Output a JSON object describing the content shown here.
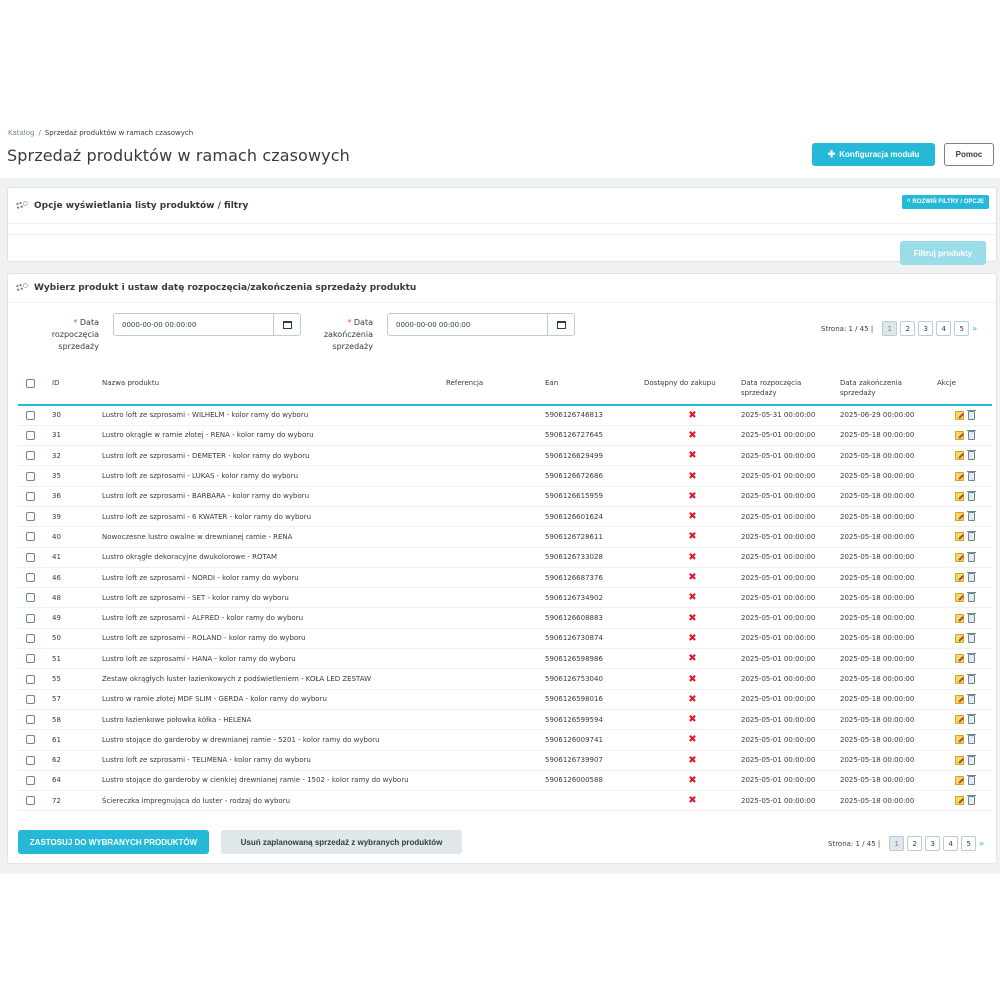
{
  "breadcrumb": {
    "parent": "Katalog",
    "separator": "/",
    "current": "Sprzedaż produktów w ramach czasowych"
  },
  "page": {
    "title": "Sprzedaż produktów w ramach czasowych"
  },
  "toolbar": {
    "config_label": "Konfiguracja modułu",
    "help_label": "Pomoc"
  },
  "filters_panel": {
    "title": "Opcje wyświetlania listy produktów / filtry",
    "expand_label": "ROZWIŃ FILTRY / OPCJE",
    "filter_button": "Filtruj produkty"
  },
  "products_panel": {
    "title": "Wybierz produkt i ustaw datę rozpoczęcia/zakończenia sprzedaży produktu",
    "start_label_1": "Data",
    "start_label_2": "rozpoczęcia",
    "start_label_3": "sprzedaży",
    "end_label_1": "Data",
    "end_label_2": "zakończenia",
    "end_label_3": "sprzedaży",
    "required_mark": "*",
    "start_value": "0000-00-00 00:00:00",
    "end_value": "0000-00-00 00:00:00",
    "apply_button": "ZASTOSUJ DO WYBRANYCH PRODUKTÓW",
    "remove_button": "Usuń zaplanowaną sprzedaż z wybranych produktów"
  },
  "pagination": {
    "info": "Strona: 1 / 45",
    "separator": "|",
    "pages": [
      "1",
      "2",
      "3",
      "4",
      "5"
    ],
    "next": "»"
  },
  "table": {
    "headers": {
      "id": "ID",
      "name": "Nazwa produktu",
      "reference": "Referencja",
      "ean": "Ean",
      "available": "Dostępny do zakupu",
      "start_1": "Data rozpoczęcia",
      "start_2": "sprzedaży",
      "end_1": "Data zakończenia",
      "end_2": "sprzedaży",
      "actions": "Akcje"
    },
    "rows": [
      {
        "id": "30",
        "name": "Lustro loft ze szprosami - WILHELM - kolor ramy do wyboru",
        "ref": "",
        "ean": "5906126746813",
        "start": "2025-05-31 00:00:00",
        "end": "2025-06-29 00:00:00"
      },
      {
        "id": "31",
        "name": "Lustro okrągłe w ramie złotej - RENA - kolor ramy do wyboru",
        "ref": "",
        "ean": "5906126727645",
        "start": "2025-05-01 00:00:00",
        "end": "2025-05-18 00:00:00"
      },
      {
        "id": "32",
        "name": "Lustro loft ze szprosami - DEMETER - kolor ramy do wyboru",
        "ref": "",
        "ean": "5906126629499",
        "start": "2025-05-01 00:00:00",
        "end": "2025-05-18 00:00:00"
      },
      {
        "id": "35",
        "name": "Lustro loft ze szprosami - LUKAS - kolor ramy do wyboru",
        "ref": "",
        "ean": "5906126672686",
        "start": "2025-05-01 00:00:00",
        "end": "2025-05-18 00:00:00"
      },
      {
        "id": "36",
        "name": "Lustro loft ze szprosami - BARBARA - kolor ramy do wyboru",
        "ref": "",
        "ean": "5906126615959",
        "start": "2025-05-01 00:00:00",
        "end": "2025-05-18 00:00:00"
      },
      {
        "id": "39",
        "name": "Lustro loft ze szprosami - 6 KWATER - kolor ramy do wyboru",
        "ref": "",
        "ean": "5906126601624",
        "start": "2025-05-01 00:00:00",
        "end": "2025-05-18 00:00:00"
      },
      {
        "id": "40",
        "name": "Nowoczesne lustro owalne w drewnianej ramie - RENA",
        "ref": "",
        "ean": "5906126728611",
        "start": "2025-05-01 00:00:00",
        "end": "2025-05-18 00:00:00"
      },
      {
        "id": "41",
        "name": "Lustro okrągłe dekoracyjne dwukolorowe - ROTAM",
        "ref": "",
        "ean": "5906126733028",
        "start": "2025-05-01 00:00:00",
        "end": "2025-05-18 00:00:00"
      },
      {
        "id": "46",
        "name": "Lustro loft ze szprosami - NORDI - kolor ramy do wyboru",
        "ref": "",
        "ean": "5906126687376",
        "start": "2025-05-01 00:00:00",
        "end": "2025-05-18 00:00:00"
      },
      {
        "id": "48",
        "name": "Lustro loft ze szprosami - SET - kolor ramy do wyboru",
        "ref": "",
        "ean": "5906126734902",
        "start": "2025-05-01 00:00:00",
        "end": "2025-05-18 00:00:00"
      },
      {
        "id": "49",
        "name": "Lustro loft ze szprosami - ALFRED - kolor ramy do wyboru",
        "ref": "",
        "ean": "5906126608883",
        "start": "2025-05-01 00:00:00",
        "end": "2025-05-18 00:00:00"
      },
      {
        "id": "50",
        "name": "Lustro loft ze szprosami - ROLAND - kolor ramy do wyboru",
        "ref": "",
        "ean": "5906126730874",
        "start": "2025-05-01 00:00:00",
        "end": "2025-05-18 00:00:00"
      },
      {
        "id": "51",
        "name": "Lustro loft ze szprosami - HANA - kolor ramy do wyboru",
        "ref": "",
        "ean": "5906126598986",
        "start": "2025-05-01 00:00:00",
        "end": "2025-05-18 00:00:00"
      },
      {
        "id": "55",
        "name": "Zestaw okrągłych luster łazienkowych z podświetleniem - KOŁA LED ZESTAW",
        "ref": "",
        "ean": "5906126753040",
        "start": "2025-05-01 00:00:00",
        "end": "2025-05-18 00:00:00"
      },
      {
        "id": "57",
        "name": "Lustro w ramie złotej MDF SLIM - GERDA - kolor ramy do wyboru",
        "ref": "",
        "ean": "5906126598016",
        "start": "2025-05-01 00:00:00",
        "end": "2025-05-18 00:00:00"
      },
      {
        "id": "58",
        "name": "Lustro łazienkowe połowka kółka - HELENA",
        "ref": "",
        "ean": "5906126599594",
        "start": "2025-05-01 00:00:00",
        "end": "2025-05-18 00:00:00"
      },
      {
        "id": "61",
        "name": "Lustro stojące do garderoby w drewnianej ramie - 5201 - kolor ramy do wyboru",
        "ref": "",
        "ean": "5906126009741",
        "start": "2025-05-01 00:00:00",
        "end": "2025-05-18 00:00:00"
      },
      {
        "id": "62",
        "name": "Lustro loft ze szprosami - TELIMENA - kolor ramy do wyboru",
        "ref": "",
        "ean": "5906126739907",
        "start": "2025-05-01 00:00:00",
        "end": "2025-05-18 00:00:00"
      },
      {
        "id": "64",
        "name": "Lustro stojące do garderoby w cienkiej drewnianej ramie - 1502 - kolor ramy do wyboru",
        "ref": "",
        "ean": "5906126000588",
        "start": "2025-05-01 00:00:00",
        "end": "2025-05-18 00:00:00"
      },
      {
        "id": "72",
        "name": "Ściereczka impregnująca do luster - rodzaj do wyboru",
        "ref": "",
        "ean": "",
        "start": "2025-05-01 00:00:00",
        "end": "2025-05-18 00:00:00"
      }
    ]
  },
  "icons": {
    "unavailable": "close-icon",
    "edit": "edit-icon",
    "delete": "delete-icon"
  },
  "colors": {
    "accent": "#25b9d7",
    "danger": "#e3162e",
    "text": "#363a41"
  }
}
